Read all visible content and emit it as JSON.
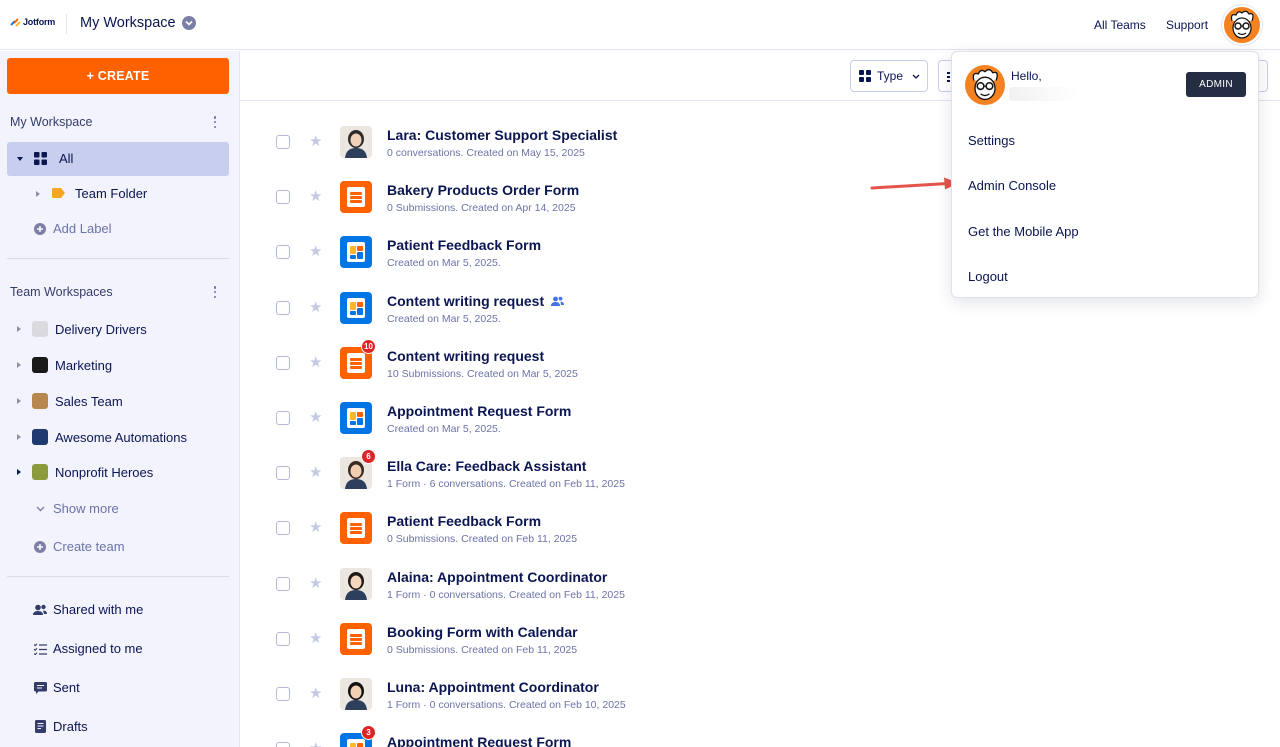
{
  "header": {
    "logo_text": "Jotform",
    "workspace_title": "My Workspace",
    "links": [
      "All Teams",
      "Support"
    ]
  },
  "sidebar": {
    "create_label": "+ CREATE",
    "my_workspace_heading": "My Workspace",
    "all_label": "All",
    "team_folder_label": "Team Folder",
    "add_label": "Add Label",
    "team_workspaces_heading": "Team Workspaces",
    "teams": [
      {
        "label": "Delivery Drivers",
        "color": "#d9d9de"
      },
      {
        "label": "Marketing",
        "color": "#1a1a1a"
      },
      {
        "label": "Sales Team",
        "color": "#b8864f"
      },
      {
        "label": "Awesome Automations",
        "color": "#1e3a6e"
      },
      {
        "label": "Nonprofit Heroes",
        "color": "#8a9a3c"
      }
    ],
    "show_more": "Show more",
    "create_team": "Create team",
    "bottom_items": [
      "Shared with me",
      "Assigned to me",
      "Sent",
      "Drafts"
    ]
  },
  "toolbar": {
    "type_label": "Type"
  },
  "items": [
    {
      "title": "Lara: Customer Support Specialist",
      "sub": "0 conversations. Created on May 15, 2025",
      "thumb": "photo"
    },
    {
      "title": "Bakery Products Order Form",
      "sub": "0 Submissions. Created on Apr 14, 2025",
      "thumb": "orange"
    },
    {
      "title": "Patient Feedback Form",
      "sub": "Created on Mar 5, 2025.",
      "thumb": "blue"
    },
    {
      "title": "Content writing request",
      "sub": "Created on Mar 5, 2025.",
      "thumb": "blue",
      "shared": true
    },
    {
      "title": "Content writing request",
      "sub": "10 Submissions. Created on Mar 5, 2025",
      "thumb": "orange",
      "badge": "10"
    },
    {
      "title": "Appointment Request Form",
      "sub": "Created on Mar 5, 2025.",
      "thumb": "blue"
    },
    {
      "title": "Ella Care: Feedback Assistant",
      "sub": "1 Form · 6 conversations. Created on Feb 11, 2025",
      "thumb": "photo",
      "badge": "6"
    },
    {
      "title": "Patient Feedback Form",
      "sub": "0 Submissions. Created on Feb 11, 2025",
      "thumb": "orange"
    },
    {
      "title": "Alaina: Appointment Coordinator",
      "sub": "1 Form · 0 conversations. Created on Feb 11, 2025",
      "thumb": "photo"
    },
    {
      "title": "Booking Form with Calendar",
      "sub": "0 Submissions. Created on Feb 11, 2025",
      "thumb": "orange"
    },
    {
      "title": "Luna: Appointment Coordinator",
      "sub": "1 Form · 0 conversations. Created on Feb 10, 2025",
      "thumb": "photo"
    },
    {
      "title": "Appointment Request Form",
      "sub": "",
      "thumb": "blue",
      "badge": "3"
    }
  ],
  "dropdown": {
    "hello": "Hello,",
    "admin_badge": "ADMIN",
    "items": [
      "Settings",
      "Admin Console",
      "Get the Mobile App",
      "Logout"
    ]
  },
  "colors": {
    "create": "#ff6100",
    "navy": "#0a1551",
    "sidebar_bg": "#f3f3fe",
    "selected": "#c8ceed",
    "annotation_arrow": "#e5534b"
  }
}
